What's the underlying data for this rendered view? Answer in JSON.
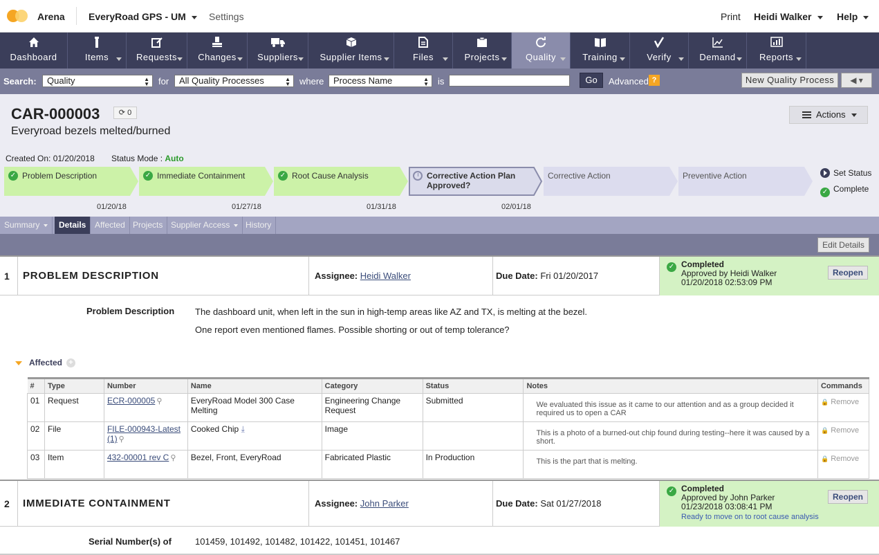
{
  "topbar": {
    "brand": "Arena",
    "workspace": "EveryRoad GPS - UM",
    "settings": "Settings",
    "print": "Print",
    "user": "Heidi Walker",
    "help": "Help"
  },
  "nav": [
    {
      "label": "Dashboard",
      "icon": "home-icon",
      "dropdown": false
    },
    {
      "label": "Items",
      "icon": "items-icon",
      "dropdown": true
    },
    {
      "label": "Requests",
      "icon": "requests-icon",
      "dropdown": true
    },
    {
      "label": "Changes",
      "icon": "changes-icon",
      "dropdown": true
    },
    {
      "label": "Suppliers",
      "icon": "truck-icon",
      "dropdown": true
    },
    {
      "label": "Supplier Items",
      "icon": "box-icon",
      "dropdown": true
    },
    {
      "label": "Files",
      "icon": "file-icon",
      "dropdown": true
    },
    {
      "label": "Projects",
      "icon": "clipboard-icon",
      "dropdown": true
    },
    {
      "label": "Quality",
      "icon": "refresh-icon",
      "dropdown": true,
      "active": true
    },
    {
      "label": "Training",
      "icon": "book-icon",
      "dropdown": true
    },
    {
      "label": "Verify",
      "icon": "check-icon",
      "dropdown": true
    },
    {
      "label": "Demand",
      "icon": "line-chart-icon",
      "dropdown": true
    },
    {
      "label": "Reports",
      "icon": "bar-chart-icon",
      "dropdown": true
    }
  ],
  "search": {
    "label": "Search:",
    "type_value": "Quality",
    "for_label": "for",
    "scope_value": "All Quality Processes",
    "where_label": "where",
    "field_value": "Process Name",
    "is_label": "is",
    "query_value": "",
    "go": "Go",
    "advanced": "Advanced",
    "help_mark": "?",
    "new_button": "New Quality Process"
  },
  "record": {
    "id": "CAR-000003",
    "revisions": "0",
    "title": "Everyroad bezels melted/burned",
    "actions": "Actions",
    "created_on": "Created On: 01/20/2018",
    "status_mode_label": "Status Mode :",
    "status_mode_value": "Auto"
  },
  "steps": [
    {
      "label": "Problem Description",
      "date": "01/20/18",
      "state": "done"
    },
    {
      "label": "Immediate Containment",
      "date": "01/27/18",
      "state": "done"
    },
    {
      "label": "Root Cause Analysis",
      "date": "01/31/18",
      "state": "done"
    },
    {
      "label": "Corrective Action Plan Approved?",
      "date": "02/01/18",
      "state": "current"
    },
    {
      "label": "Corrective Action",
      "date": "",
      "state": "pending"
    },
    {
      "label": "Preventive Action",
      "date": "",
      "state": "pending"
    }
  ],
  "set_status": "Set Status",
  "complete": "Complete",
  "subtabs": [
    {
      "label": "Summary",
      "dropdown": true
    },
    {
      "label": "Details",
      "active": true
    },
    {
      "label": "Affected"
    },
    {
      "label": "Projects"
    },
    {
      "label": "Supplier Access",
      "dropdown": true
    },
    {
      "label": "History"
    }
  ],
  "edit_details": "Edit Details",
  "sections": [
    {
      "num": "1",
      "title": "PROBLEM DESCRIPTION",
      "assignee_label": "Assignee:",
      "assignee": "Heidi Walker",
      "due_label": "Due Date:",
      "due": "Fri 01/20/2017",
      "status": "Completed",
      "approved_by": "Approved by Heidi Walker",
      "approved_at": "01/20/2018 02:53:09 PM",
      "note": "",
      "reopen": "Reopen"
    },
    {
      "num": "2",
      "title": "IMMEDIATE CONTAINMENT",
      "assignee_label": "Assignee:",
      "assignee": "John Parker",
      "due_label": "Due Date:",
      "due": "Sat 01/27/2018",
      "status": "Completed",
      "approved_by": "Approved by John Parker",
      "approved_at": "01/23/2018 03:08:41 PM",
      "note": "Ready to move on to root cause analysis",
      "reopen": "Reopen"
    }
  ],
  "problem": {
    "label": "Problem Description",
    "text": "The dashboard unit, when left in the sun in high-temp areas like AZ and TX, is melting at the bezel. One report even mentioned flames. Possible shorting or out of temp tolerance?"
  },
  "affected": {
    "heading": "Affected",
    "columns": [
      "#",
      "Type",
      "Number",
      "Name",
      "Category",
      "Status",
      "Notes",
      "Commands"
    ],
    "rows": [
      {
        "n": "01",
        "type": "Request",
        "number": "ECR-000005",
        "name": "EveryRoad Model 300 Case Melting",
        "category": "Engineering Change Request",
        "status": "Submitted",
        "notes": "We evaluated this issue as it came to our attention and as a group decided it required us to open a CAR",
        "command": "Remove"
      },
      {
        "n": "02",
        "type": "File",
        "number": "FILE-000943-Latest (1)",
        "name": "Cooked Chip",
        "category": "Image",
        "status": "",
        "notes": "This is a photo of a burned-out chip found during testing--here it was caused by a short.",
        "command": "Remove"
      },
      {
        "n": "03",
        "type": "Item",
        "number": "432-00001 rev C",
        "name": "Bezel, Front, EveryRoad",
        "category": "Fabricated Plastic",
        "status": "In Production",
        "notes": "This is the part that is melting.",
        "command": "Remove"
      }
    ]
  },
  "serial": {
    "label": "Serial Number(s) of",
    "value": "101459, 101492, 101482, 101422, 101451, 101467"
  }
}
